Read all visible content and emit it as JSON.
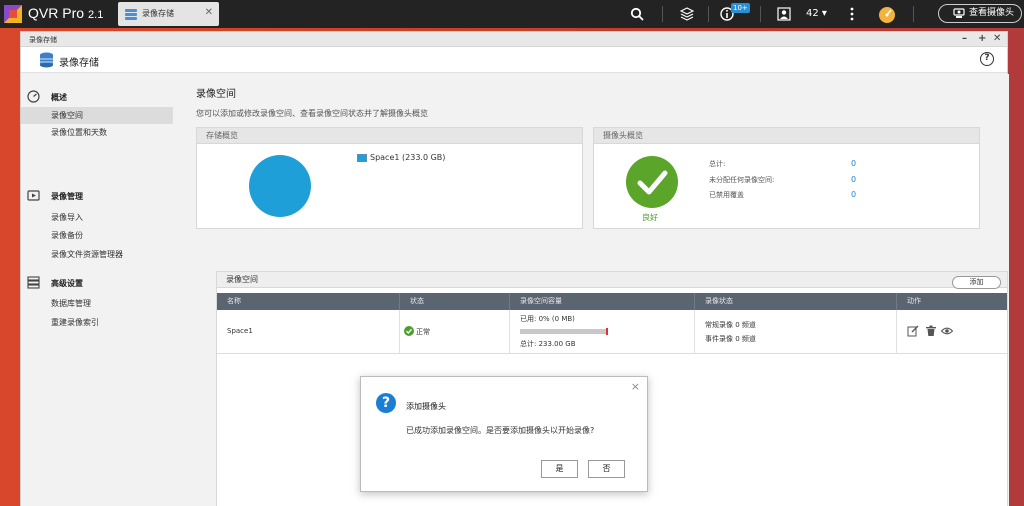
{
  "taskbar": {
    "app_name": "QVR Pro",
    "app_version": "2.1",
    "tab_label": "录像存储",
    "notification_badge": "10+",
    "user_count": "42 ▾",
    "view_camera_label": "查看摄像头"
  },
  "window": {
    "title": "录像存储",
    "header_title": "录像存储",
    "help_glyph": "?"
  },
  "sidebar": {
    "groups": [
      {
        "label": "概述",
        "icon": "dashboard-icon",
        "items": [
          "录像空间",
          "录像位置和天数"
        ]
      },
      {
        "label": "录像管理",
        "icon": "recording-icon",
        "items": [
          "录像导入",
          "录像备份",
          "录像文件资源管理器"
        ]
      },
      {
        "label": "高级设置",
        "icon": "database-icon",
        "items": [
          "数据库管理",
          "重建录像索引"
        ]
      }
    ],
    "active_item": "录像空间"
  },
  "main": {
    "title": "录像空间",
    "description": "您可以添加或修改录像空间、查看录像空间状态并了解摄像头概览",
    "storage_panel": {
      "title": "存储概览",
      "legend": "Space1 (233.0 GB)"
    },
    "camera_panel": {
      "title": "摄像头概览",
      "status_label": "良好",
      "stats": [
        {
          "label": "总计:",
          "value": "0"
        },
        {
          "label": "未分配任何录像空间:",
          "value": "0"
        },
        {
          "label": "已禁用覆盖",
          "value": "0"
        }
      ]
    },
    "space_panel": {
      "title": "录像空间",
      "add_button": "添加",
      "columns": [
        "名称",
        "状态",
        "录像空间容量",
        "录像状态",
        "动作"
      ],
      "rows": [
        {
          "name": "Space1",
          "status": "正常",
          "used": "已用: 0% (0 MB)",
          "used_fraction": 0.0,
          "total": "总计: 233.00 GB",
          "rec_normal": "常规录像 0 频道",
          "rec_event": "事件录像 0 频道"
        }
      ]
    }
  },
  "dialog": {
    "title": "添加摄像头",
    "message": "已成功添加录像空间。是否要添加摄像头以开始录像?",
    "yes": "是",
    "no": "否",
    "close_glyph": "×"
  },
  "colors": {
    "accent_blue": "#1f9fd8",
    "ok_green": "#5aa52a",
    "table_header": "#5b6471"
  }
}
